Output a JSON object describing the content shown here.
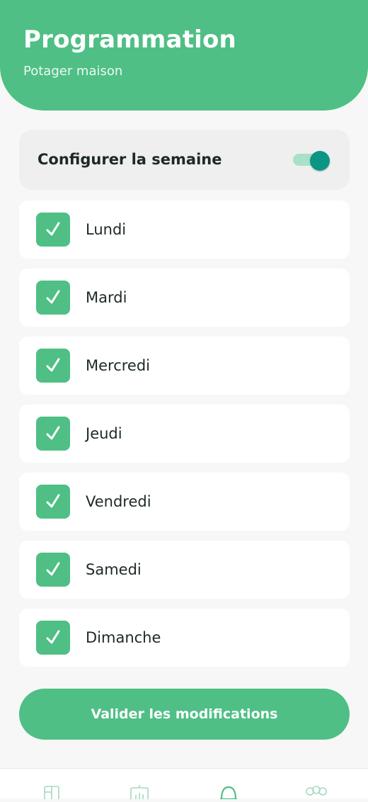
{
  "header": {
    "title": "Programmation",
    "subtitle": "Potager maison"
  },
  "week_config": {
    "label": "Configurer la semaine",
    "enabled": true
  },
  "days": [
    {
      "label": "Lundi",
      "checked": true
    },
    {
      "label": "Mardi",
      "checked": true
    },
    {
      "label": "Mercredi",
      "checked": true
    },
    {
      "label": "Jeudi",
      "checked": true
    },
    {
      "label": "Vendredi",
      "checked": true
    },
    {
      "label": "Samedi",
      "checked": true
    },
    {
      "label": "Dimanche",
      "checked": true
    }
  ],
  "submit": {
    "label": "Valider les modifications"
  },
  "colors": {
    "primary": "#4fbf85",
    "toggle_on": "#0b9585",
    "toggle_track": "#a9e1c8",
    "text_dark": "#1d2a22"
  },
  "nav": [
    {
      "icon": "layout-icon"
    },
    {
      "icon": "chart-icon"
    },
    {
      "icon": "bell-icon"
    },
    {
      "icon": "community-icon"
    }
  ]
}
